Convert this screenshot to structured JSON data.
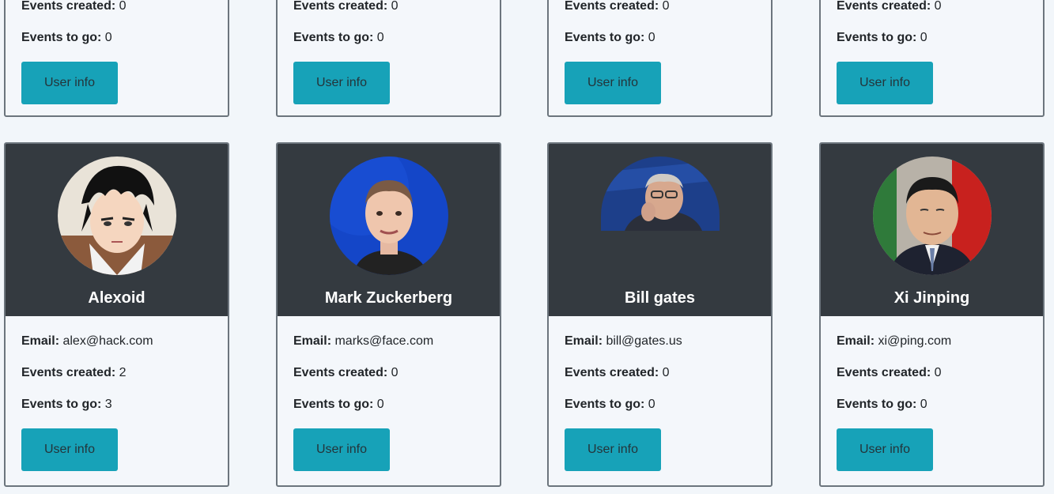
{
  "labels": {
    "email": "Email:",
    "events_created": "Events created:",
    "events_to_go": "Events to go:",
    "user_info_button": "User info"
  },
  "top_row": [
    {
      "events_created": "0",
      "events_to_go": "0"
    },
    {
      "events_created": "0",
      "events_to_go": "0"
    },
    {
      "events_created": "0",
      "events_to_go": "0"
    },
    {
      "events_created": "0",
      "events_to_go": "0"
    }
  ],
  "users": [
    {
      "name": "Alexoid",
      "email": "alex@hack.com",
      "events_created": "2",
      "events_to_go": "3",
      "avatar": "anime-character-avatar"
    },
    {
      "name": "Mark Zuckerberg",
      "email": "marks@face.com",
      "events_created": "0",
      "events_to_go": "0",
      "avatar": "portrait-avatar"
    },
    {
      "name": "Bill gates",
      "email": "bill@gates.us",
      "events_created": "0",
      "events_to_go": "0",
      "avatar": "portrait-avatar"
    },
    {
      "name": "Xi Jinping",
      "email": "xi@ping.com",
      "events_created": "0",
      "events_to_go": "0",
      "avatar": "portrait-avatar"
    }
  ],
  "colors": {
    "page_bg": "#f2f6fa",
    "card_header": "#343a40",
    "button": "#17a2b8",
    "card_border": "#6c757d"
  }
}
